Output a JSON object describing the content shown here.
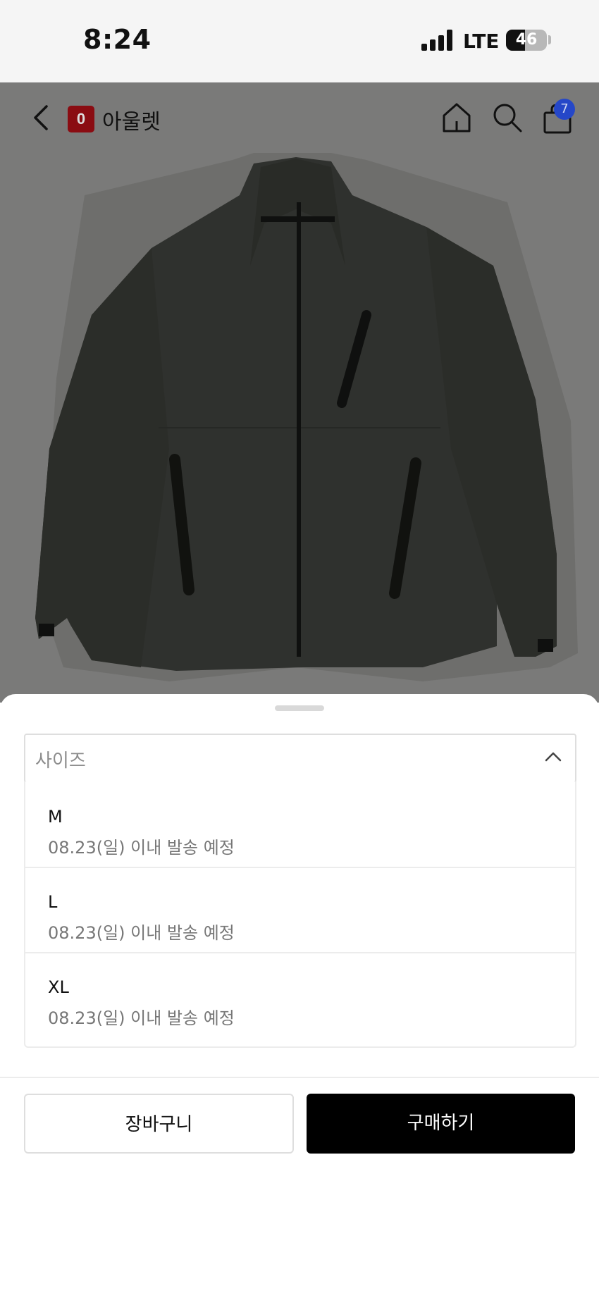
{
  "status_bar": {
    "time": "8:24",
    "network": "LTE",
    "battery": "46",
    "battery_level": 0.46
  },
  "nav": {
    "back_icon": "chevron-left-icon",
    "brand_logo_letter": "0",
    "brand_name": "아울렛",
    "home_icon": "home-icon",
    "search_icon": "search-icon",
    "cart_icon": "shopping-bag-icon",
    "cart_count": "7"
  },
  "product": {
    "image_subject": "jacket-image"
  },
  "sheet": {
    "select_label": "사이즈",
    "select_icon": "chevron-up-icon",
    "options": [
      {
        "size": "M",
        "shipping": "08.23(일) 이내 발송 예정"
      },
      {
        "size": "L",
        "shipping": "08.23(일) 이내 발송 예정"
      },
      {
        "size": "XL",
        "shipping": "08.23(일) 이내 발송 예정"
      }
    ],
    "cart_button": "장바구니",
    "buy_button": "구매하기"
  },
  "colors": {
    "accent": "#000000",
    "badge": "#2547c8",
    "brand": "#c4121a",
    "overlay": "rgba(0,0,0,0.5)"
  }
}
